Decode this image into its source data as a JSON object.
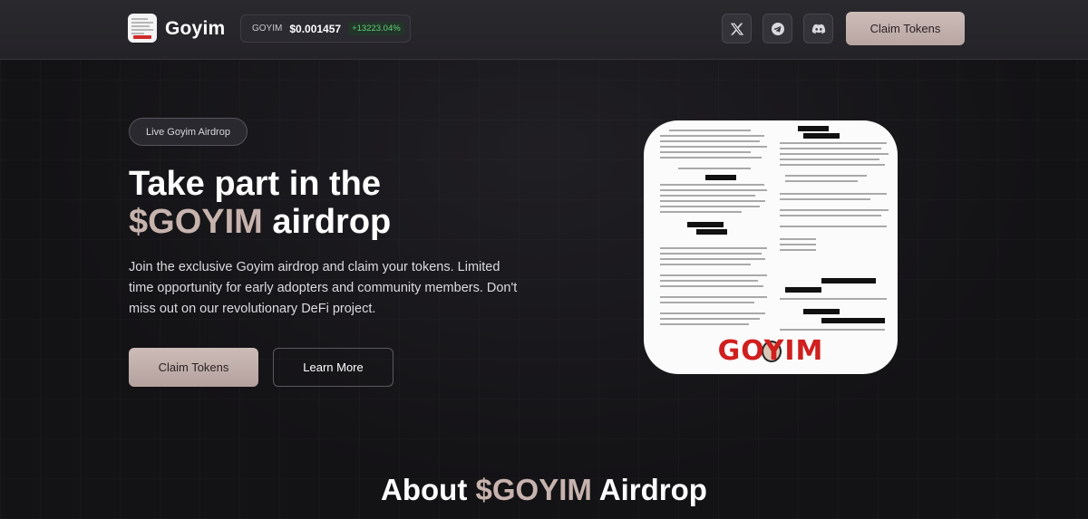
{
  "header": {
    "brand": "Goyim",
    "ticker": {
      "symbol": "GOYIM",
      "price": "$0.001457",
      "change": "+13223.04%"
    },
    "social": [
      {
        "name": "x-icon"
      },
      {
        "name": "telegram-icon"
      },
      {
        "name": "discord-icon"
      }
    ],
    "claim_label": "Claim Tokens"
  },
  "hero": {
    "pill": "Live Goyim Airdrop",
    "title_line1": "Take part in the",
    "title_accent": "$GOYIM",
    "title_rest": " airdrop",
    "description": "Join the exclusive Goyim airdrop and claim your tokens. Limited time opportunity for early adopters and community members. Don't miss out on our revolutionary DeFi project.",
    "claim_label": "Claim Tokens",
    "learn_label": "Learn More",
    "image_word": "GOYIM"
  },
  "about": {
    "prefix": "About ",
    "accent": "$GOYIM",
    "suffix": " Airdrop"
  },
  "colors": {
    "background": "#131215",
    "accent": "#c7b3ae",
    "button": "#c4b2ae",
    "positive": "#5fd07a"
  }
}
